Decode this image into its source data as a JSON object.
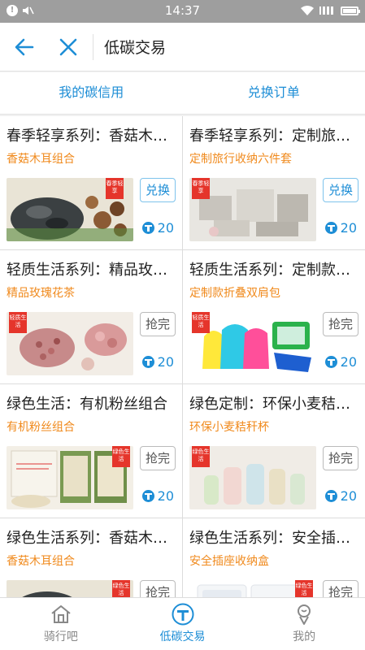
{
  "status": {
    "time": "14:37"
  },
  "header": {
    "title": "低碳交易",
    "back_icon": "arrow-left-icon",
    "close_icon": "close-icon"
  },
  "subnav": {
    "tabs": [
      {
        "label": "我的碳信用"
      },
      {
        "label": "兑换订单"
      }
    ]
  },
  "products": [
    {
      "title": "春季轻享系列：香菇木耳组合",
      "subtitle": "香菇木耳组合",
      "button": "兑换",
      "price": "20",
      "badge": "春季轻享",
      "active": true
    },
    {
      "title": "春季轻享系列：定制旅行收纳六件套",
      "subtitle": "定制旅行收纳六件套",
      "button": "兑换",
      "price": "20",
      "badge": "春季轻享",
      "active": true
    },
    {
      "title": "轻质生活系列：精品玫瑰花茶",
      "subtitle": "精品玫瑰花茶",
      "button": "抢完",
      "price": "20",
      "badge": "轻质生活",
      "active": false
    },
    {
      "title": "轻质生活系列：定制款折叠双肩包",
      "subtitle": "定制款折叠双肩包",
      "button": "抢完",
      "price": "20",
      "badge": "轻质生活",
      "active": false
    },
    {
      "title": "绿色生活：有机粉丝组合",
      "subtitle": "有机粉丝组合",
      "button": "抢完",
      "price": "20",
      "badge": "绿色生活",
      "active": false
    },
    {
      "title": "绿色定制：环保小麦秸秆杯",
      "subtitle": "环保小麦秸秆杯",
      "button": "抢完",
      "price": "20",
      "badge": "绿色生活",
      "active": false
    },
    {
      "title": "绿色生活系列：香菇木耳组合",
      "subtitle": "香菇木耳组合",
      "button": "抢完",
      "price": "20",
      "badge": "绿色生活",
      "active": false
    },
    {
      "title": "绿色生活系列：安全插座收纳盒",
      "subtitle": "安全插座收纳盒",
      "button": "抢完",
      "price": "20",
      "badge": "绿色生活",
      "active": false
    }
  ],
  "bottomnav": {
    "items": [
      {
        "label": "骑行吧",
        "icon": "home-icon"
      },
      {
        "label": "低碳交易",
        "icon": "trade-icon"
      },
      {
        "label": "我的",
        "icon": "profile-icon"
      }
    ]
  },
  "colors": {
    "accent": "#1e8ed6",
    "orange": "#f08a1d",
    "badge": "#e5352b"
  }
}
